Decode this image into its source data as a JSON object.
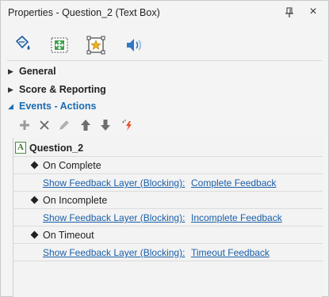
{
  "window": {
    "title": "Properties - Question_2 (Text Box)",
    "pin_icon": "pin-icon",
    "close_glyph": "×"
  },
  "toolbar_icons": [
    "fill-bucket-icon",
    "size-position-icon",
    "star-frame-icon",
    "audio-icon"
  ],
  "sections": [
    {
      "label": "General",
      "expanded": false
    },
    {
      "label": "Score & Reporting",
      "expanded": false
    },
    {
      "label": "Events - Actions",
      "expanded": true
    }
  ],
  "action_toolbar": [
    "add-icon",
    "delete-icon",
    "edit-icon",
    "move-up-icon",
    "move-down-icon",
    "lightning-icon"
  ],
  "object": {
    "name": "Question_2",
    "icon_letter": "A"
  },
  "events": [
    {
      "name": "On Complete",
      "action": "Show Feedback Layer (Blocking):",
      "target": "Complete Feedback"
    },
    {
      "name": "On Incomplete",
      "action": "Show Feedback Layer (Blocking):",
      "target": "Incomplete Feedback"
    },
    {
      "name": "On Timeout",
      "action": "Show Feedback Layer (Blocking):",
      "target": "Timeout Feedback"
    }
  ],
  "colors": {
    "accent": "#1c6bb0",
    "link": "#1a5fa8"
  }
}
